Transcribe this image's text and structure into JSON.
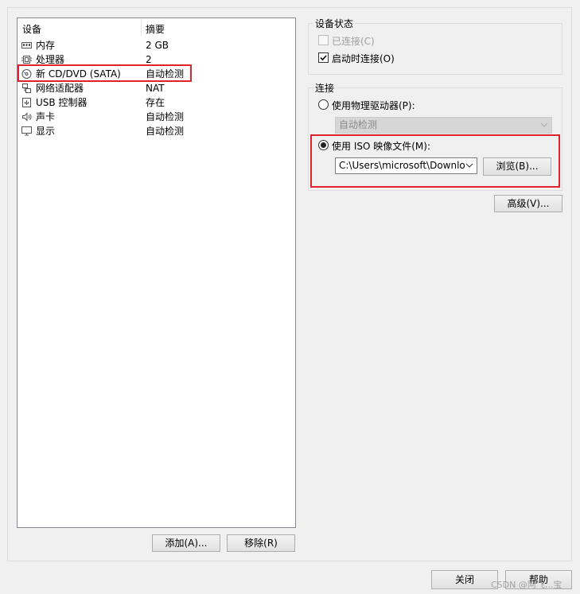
{
  "device_list": {
    "col_device": "设备",
    "col_summary": "摘要",
    "items": [
      {
        "name": "内存",
        "summary": "2 GB",
        "icon": "memory-icon"
      },
      {
        "name": "处理器",
        "summary": "2",
        "icon": "processor-icon"
      },
      {
        "name": "新 CD/DVD (SATA)",
        "summary": "自动检测",
        "icon": "cd-dvd-icon"
      },
      {
        "name": "网络适配器",
        "summary": "NAT",
        "icon": "network-adapter-icon"
      },
      {
        "name": "USB 控制器",
        "summary": "存在",
        "icon": "usb-icon"
      },
      {
        "name": "声卡",
        "summary": "自动检测",
        "icon": "sound-card-icon"
      },
      {
        "name": "显示",
        "summary": "自动检测",
        "icon": "display-icon"
      }
    ],
    "selected_index": 2
  },
  "buttons": {
    "add": "添加(A)...",
    "remove": "移除(R)",
    "close": "关闭",
    "help": "帮助",
    "browse": "浏览(B)...",
    "advanced": "高级(V)..."
  },
  "device_status": {
    "title": "设备状态",
    "connected_label": "已连接(C)",
    "connected_checked": false,
    "connected_enabled": false,
    "connect_at_power_on_label": "启动时连接(O)",
    "connect_at_power_on_checked": true
  },
  "connection": {
    "title": "连接",
    "physical_drive_label": "使用物理驱动器(P):",
    "physical_drive_value": "自动检测",
    "iso_label": "使用 ISO 映像文件(M):",
    "iso_path": "C:\\Users\\microsoft\\Downloa",
    "selected_option": "iso"
  },
  "watermark": "CSDN @阿飞...宝",
  "colors": {
    "highlight_border": "#e0212e",
    "panel_bg": "#f0f0f0"
  }
}
